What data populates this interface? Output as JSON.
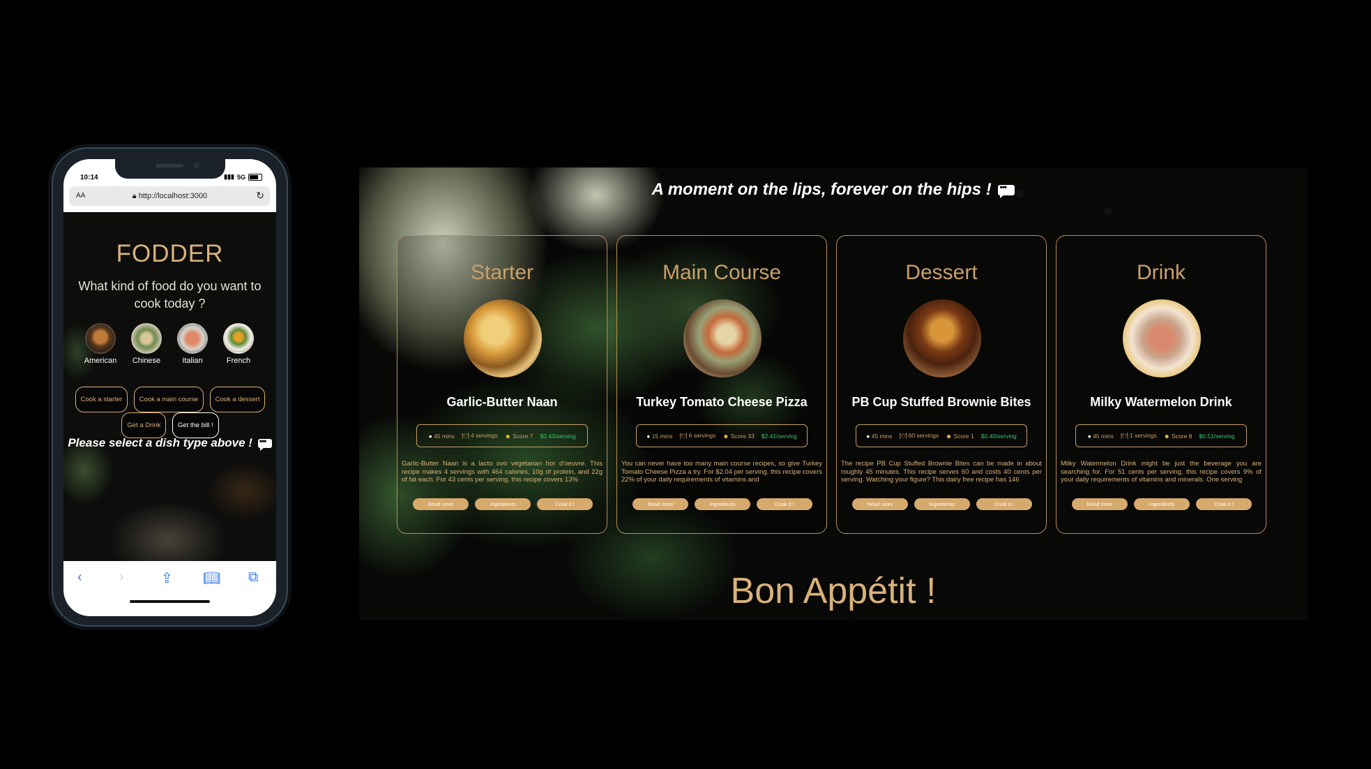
{
  "phone": {
    "status": {
      "time": "10:14",
      "network": "5G"
    },
    "browser": {
      "aa": "AA",
      "url": "http://localhost:3000"
    },
    "app": {
      "title": "FODDER",
      "question": "What kind of food do you want to cook today ?",
      "cuisines": [
        {
          "label": "American"
        },
        {
          "label": "Chinese"
        },
        {
          "label": "Italian"
        },
        {
          "label": "French"
        }
      ],
      "buttons": {
        "starter": "Cook a starter",
        "main": "Cook a main course",
        "dessert": "Cook a dessert",
        "drink": "Get a Drink",
        "bill": "Get the bill !"
      },
      "select_msg": "Please select a dish type above !"
    }
  },
  "desktop": {
    "tagline": "A moment on the lips, forever on the hips !",
    "footer": "Bon Appétit !",
    "buttons": {
      "read_more": "Read more",
      "ingredients": "Ingredients",
      "cook": "Cook it !"
    },
    "cards": [
      {
        "category": "Starter",
        "title": "Garlic-Butter Naan",
        "time": "45 mins",
        "servings": "4 servings",
        "score": "Score 7",
        "price": "$0.43/serving",
        "description": "Garlic-Butter Naan is a lacto ovo vegetarian hor d'oeuvre. This recipe makes 4 servings with 464 calories, 10g of protein, and 22g of fat each. For 43 cents per serving, this recipe covers 13%"
      },
      {
        "category": "Main Course",
        "title": "Turkey Tomato Cheese Pizza",
        "time": "15 mins",
        "servings": "6 servings",
        "score": "Score 33",
        "price": "$2.41/serving",
        "description": "You can never have too many main course recipes, so give Turkey Tomato Cheese Pizza a try. For $2.04 per serving, this recipe covers 22% of your daily requirements of vitamins and"
      },
      {
        "category": "Dessert",
        "title": "PB Cup Stuffed Brownie Bites",
        "time": "45 mins",
        "servings": "60 servings",
        "score": "Score 1",
        "price": "$0.40/serving",
        "description": "The recipe PB Cup Stuffed Brownie Bites can be made in about roughly 45 minutes. This recipe serves 60 and costs 40 cents per serving. Watching your figure? This dairy free recipe has 146"
      },
      {
        "category": "Drink",
        "title": "Milky Watermelon Drink",
        "time": "45 mins",
        "servings": "1 servings",
        "score": "Score 8",
        "price": "$0.51/serving",
        "description": "Milky Watermelon Drink might be just the beverage you are searching for. For 51 cents per serving, this recipe covers 9% of your daily requirements of vitamins and minerals. One serving"
      }
    ]
  },
  "icons": {
    "time": "clock-icon",
    "servings": "cutlery-icon",
    "score": "smiley-icon",
    "chat": "speech-bubble-icon"
  },
  "colors": {
    "accent": "#d9b27a",
    "border": "#b98f57",
    "price": "#37c871",
    "button": "#d6a96d"
  }
}
